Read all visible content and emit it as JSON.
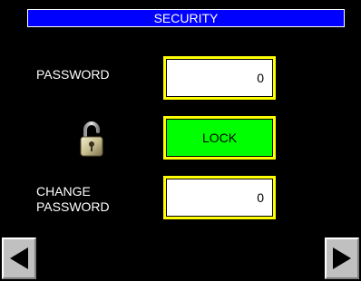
{
  "window": {
    "title": "SECURITY"
  },
  "password": {
    "label": "PASSWORD",
    "value": "0"
  },
  "lock": {
    "icon": "padlock-open-icon",
    "button_label": "LOCK",
    "button_color": "#00ff00"
  },
  "change_password": {
    "label": "CHANGE\nPASSWORD",
    "value": "0"
  },
  "navigation": {
    "prev_icon": "arrow-left-icon",
    "next_icon": "arrow-right-icon"
  },
  "colors": {
    "background": "#000000",
    "title_bar": "#0000ff",
    "field_border": "#ffff00",
    "nav_button": "#c0c0c0"
  }
}
